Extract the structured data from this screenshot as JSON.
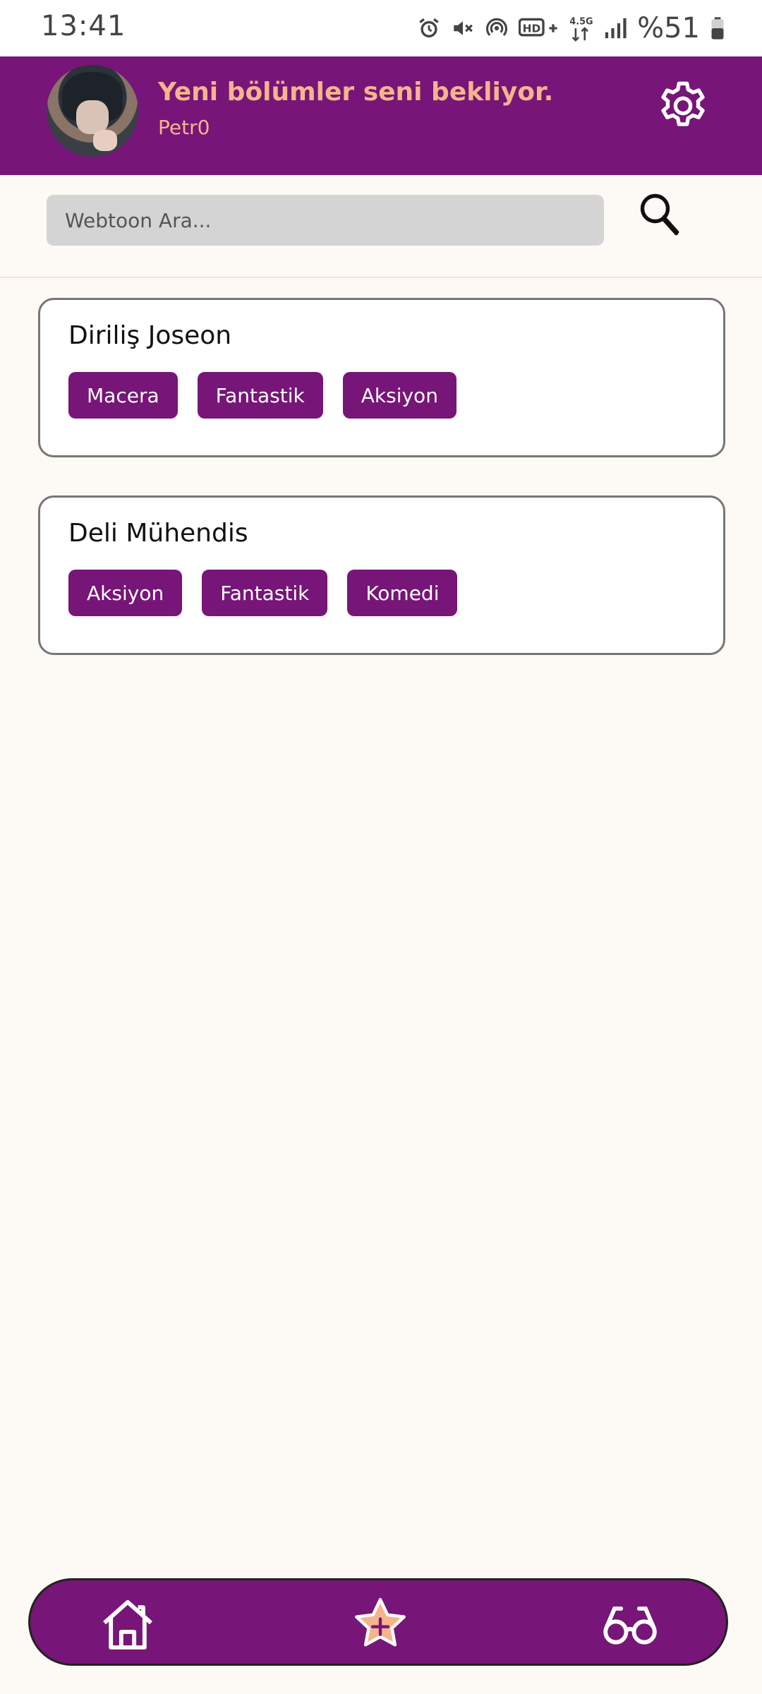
{
  "status_bar": {
    "time": "13:41",
    "battery": "%51",
    "icons": [
      "alarm-icon",
      "mute-icon",
      "hotspot-icon",
      "hd-volte-icon",
      "network-4-5g-icon",
      "signal-icon",
      "battery-icon"
    ]
  },
  "header": {
    "title": "Yeni bölümler seni bekliyor.",
    "username": "Petr0",
    "settings_icon": "gear-icon"
  },
  "search": {
    "placeholder": "Webtoon Ara...",
    "value": "",
    "icon": "search-icon"
  },
  "webtoons": [
    {
      "title": "Diriliş Joseon",
      "genres": [
        "Macera",
        "Fantastik",
        "Aksiyon"
      ]
    },
    {
      "title": "Deli Mühendis",
      "genres": [
        "Aksiyon",
        "Fantastik",
        "Komedi"
      ]
    }
  ],
  "bottom_nav": {
    "items": [
      "home-icon",
      "favorites-star-icon",
      "discover-binoculars-icon"
    ]
  },
  "colors": {
    "brand": "#771578",
    "accent": "#f5b48c",
    "background": "#fdf9f4",
    "search_field": "#d4d4d4"
  }
}
